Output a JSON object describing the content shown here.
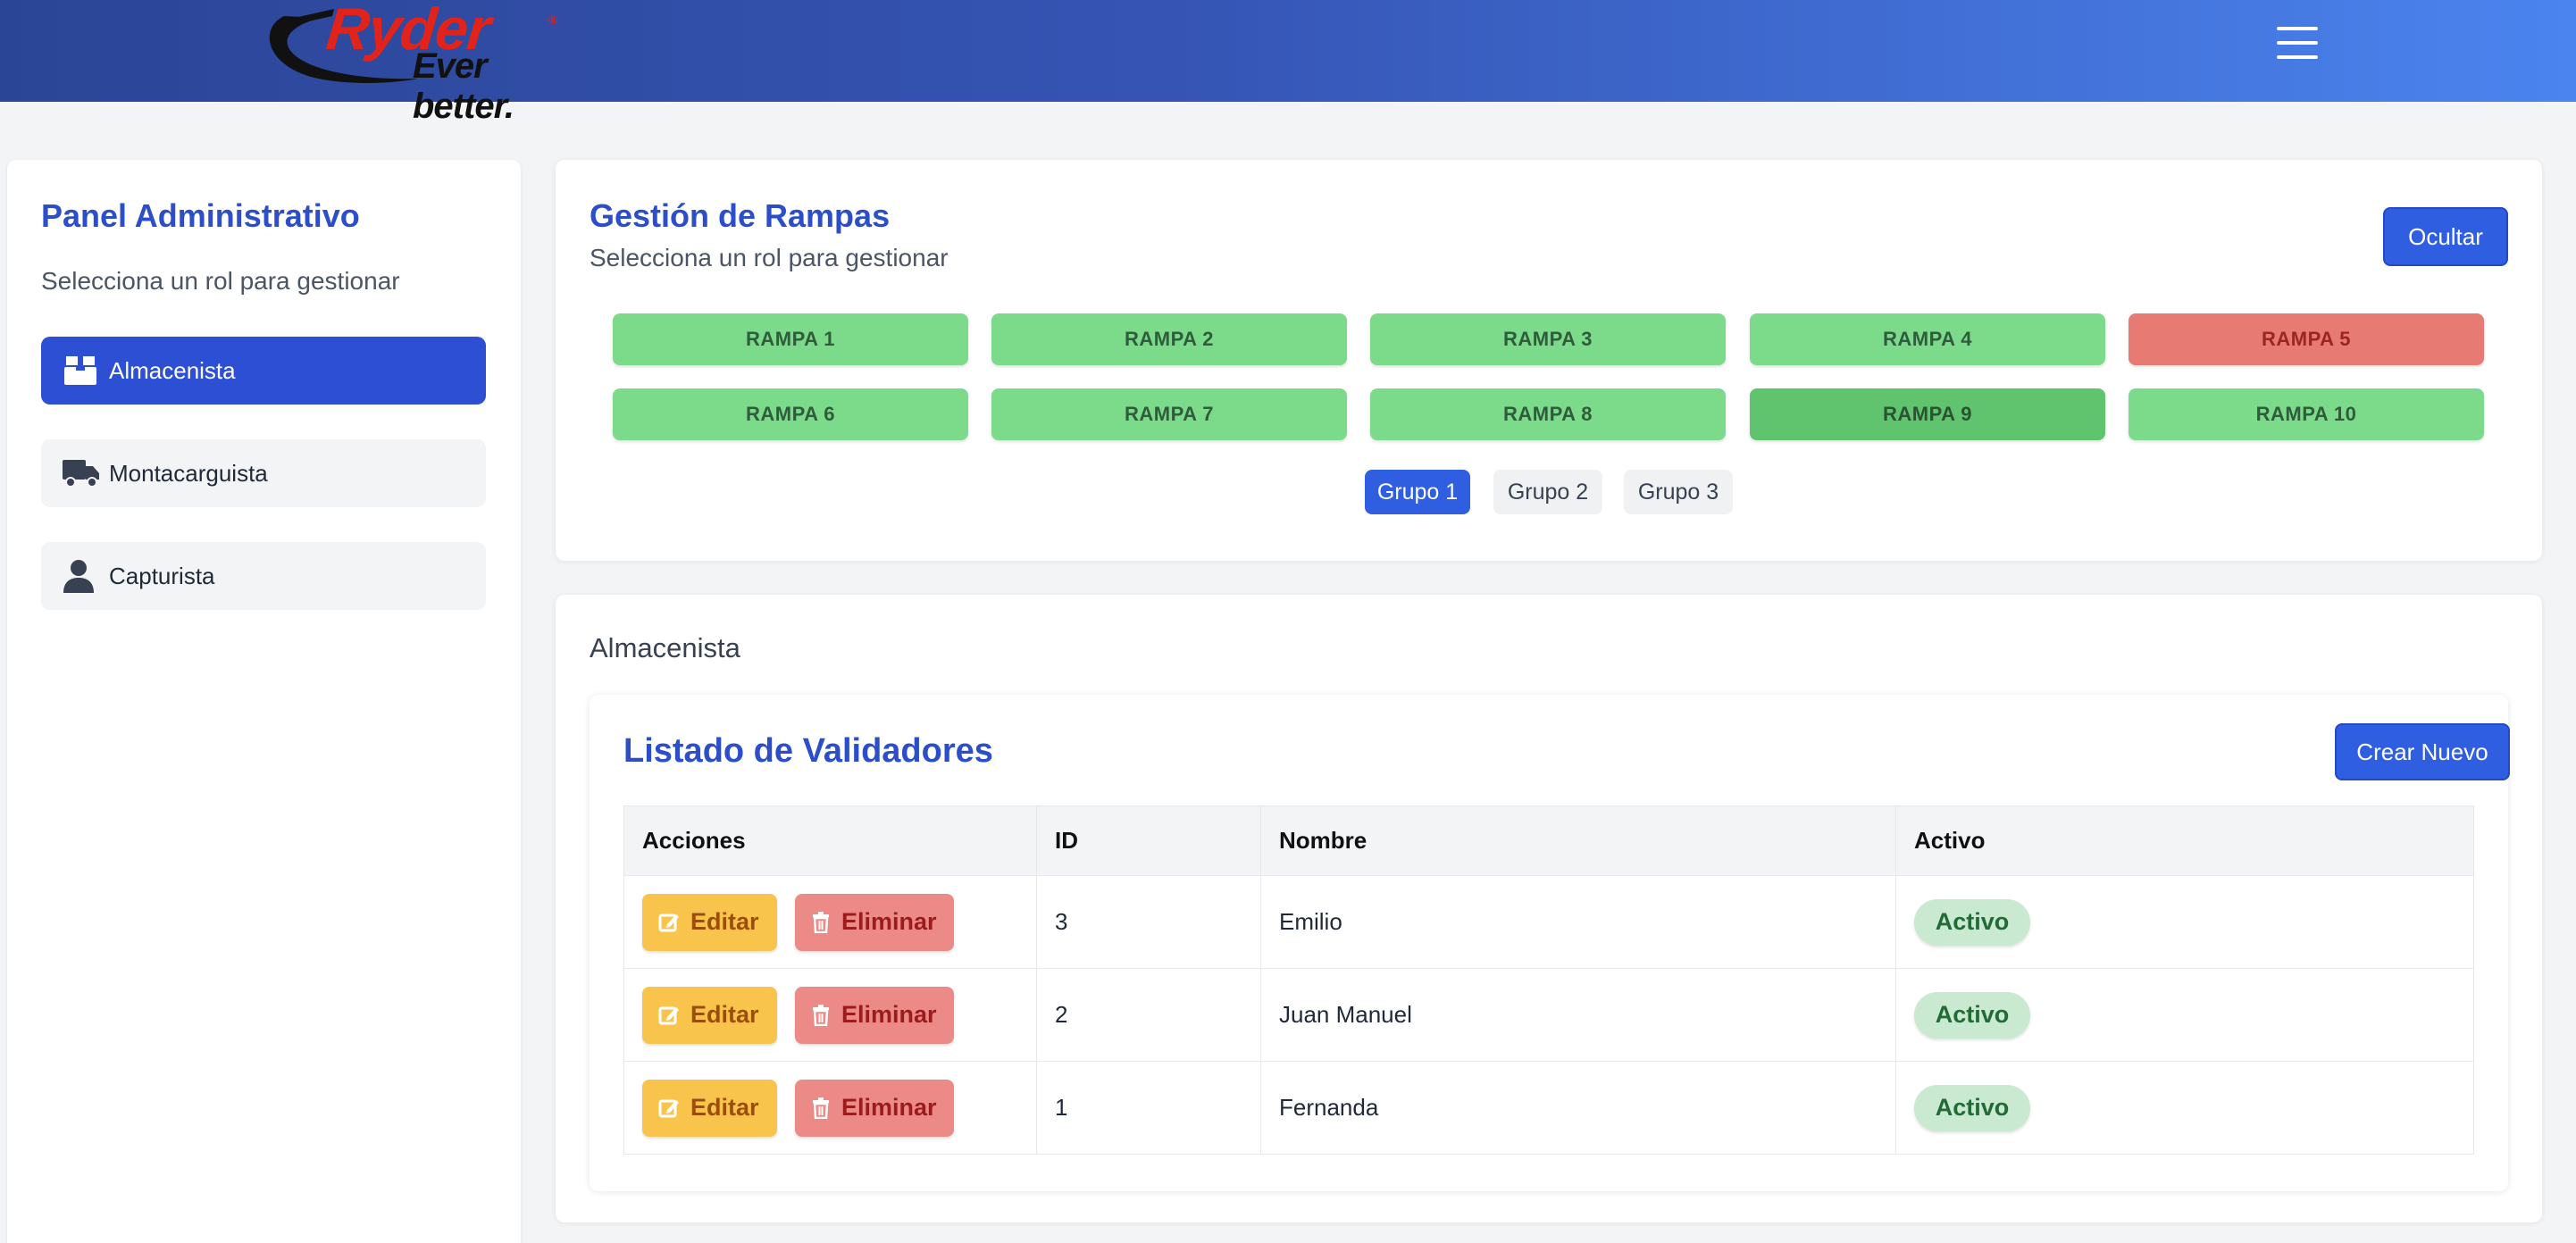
{
  "header": {
    "logo_brand": "Ryder",
    "logo_reg": "®",
    "logo_tagline": "Ever better.",
    "menu_icon": "hamburger-menu-icon"
  },
  "sidebar": {
    "title": "Panel Administrativo",
    "subtitle": "Selecciona un rol para gestionar",
    "items": [
      {
        "label": "Almacenista",
        "icon": "box-icon",
        "active": true
      },
      {
        "label": "Montacarguista",
        "icon": "truck-icon",
        "active": false
      },
      {
        "label": "Capturista",
        "icon": "user-icon",
        "active": false
      }
    ]
  },
  "rampas": {
    "title": "Gestión de Rampas",
    "subtitle": "Selecciona un rol para gestionar",
    "hide_button": "Ocultar",
    "items": [
      {
        "label": "RAMPA 1",
        "status": "green"
      },
      {
        "label": "RAMPA 2",
        "status": "green"
      },
      {
        "label": "RAMPA 3",
        "status": "green"
      },
      {
        "label": "RAMPA 4",
        "status": "green"
      },
      {
        "label": "RAMPA 5",
        "status": "red"
      },
      {
        "label": "RAMPA 6",
        "status": "green"
      },
      {
        "label": "RAMPA 7",
        "status": "green"
      },
      {
        "label": "RAMPA 8",
        "status": "green"
      },
      {
        "label": "RAMPA 9",
        "status": "green-selected"
      },
      {
        "label": "RAMPA 10",
        "status": "green"
      }
    ],
    "groups": [
      {
        "label": "Grupo 1",
        "active": true
      },
      {
        "label": "Grupo 2",
        "active": false
      },
      {
        "label": "Grupo 3",
        "active": false
      }
    ]
  },
  "role_panel": {
    "role_title": "Almacenista",
    "list_title": "Listado de Validadores",
    "create_button": "Crear Nuevo",
    "columns": [
      "Acciones",
      "ID",
      "Nombre",
      "Activo"
    ],
    "edit_label": "Editar",
    "delete_label": "Eliminar",
    "rows": [
      {
        "id": "3",
        "nombre": "Emilio",
        "activo": "Activo"
      },
      {
        "id": "2",
        "nombre": "Juan Manuel",
        "activo": "Activo"
      },
      {
        "id": "1",
        "nombre": "Fernanda",
        "activo": "Activo"
      }
    ]
  },
  "colors": {
    "header_start": "#2b4596",
    "header_end": "#4b84ef",
    "accent_blue": "#2f5ee0",
    "title_blue": "#2c4ec9",
    "rampa_green": "#7bdb8a",
    "rampa_red": "#e77a72",
    "edit_yellow": "#f8c44c",
    "delete_red": "#ec8a87",
    "badge_green": "#c9ead0"
  }
}
